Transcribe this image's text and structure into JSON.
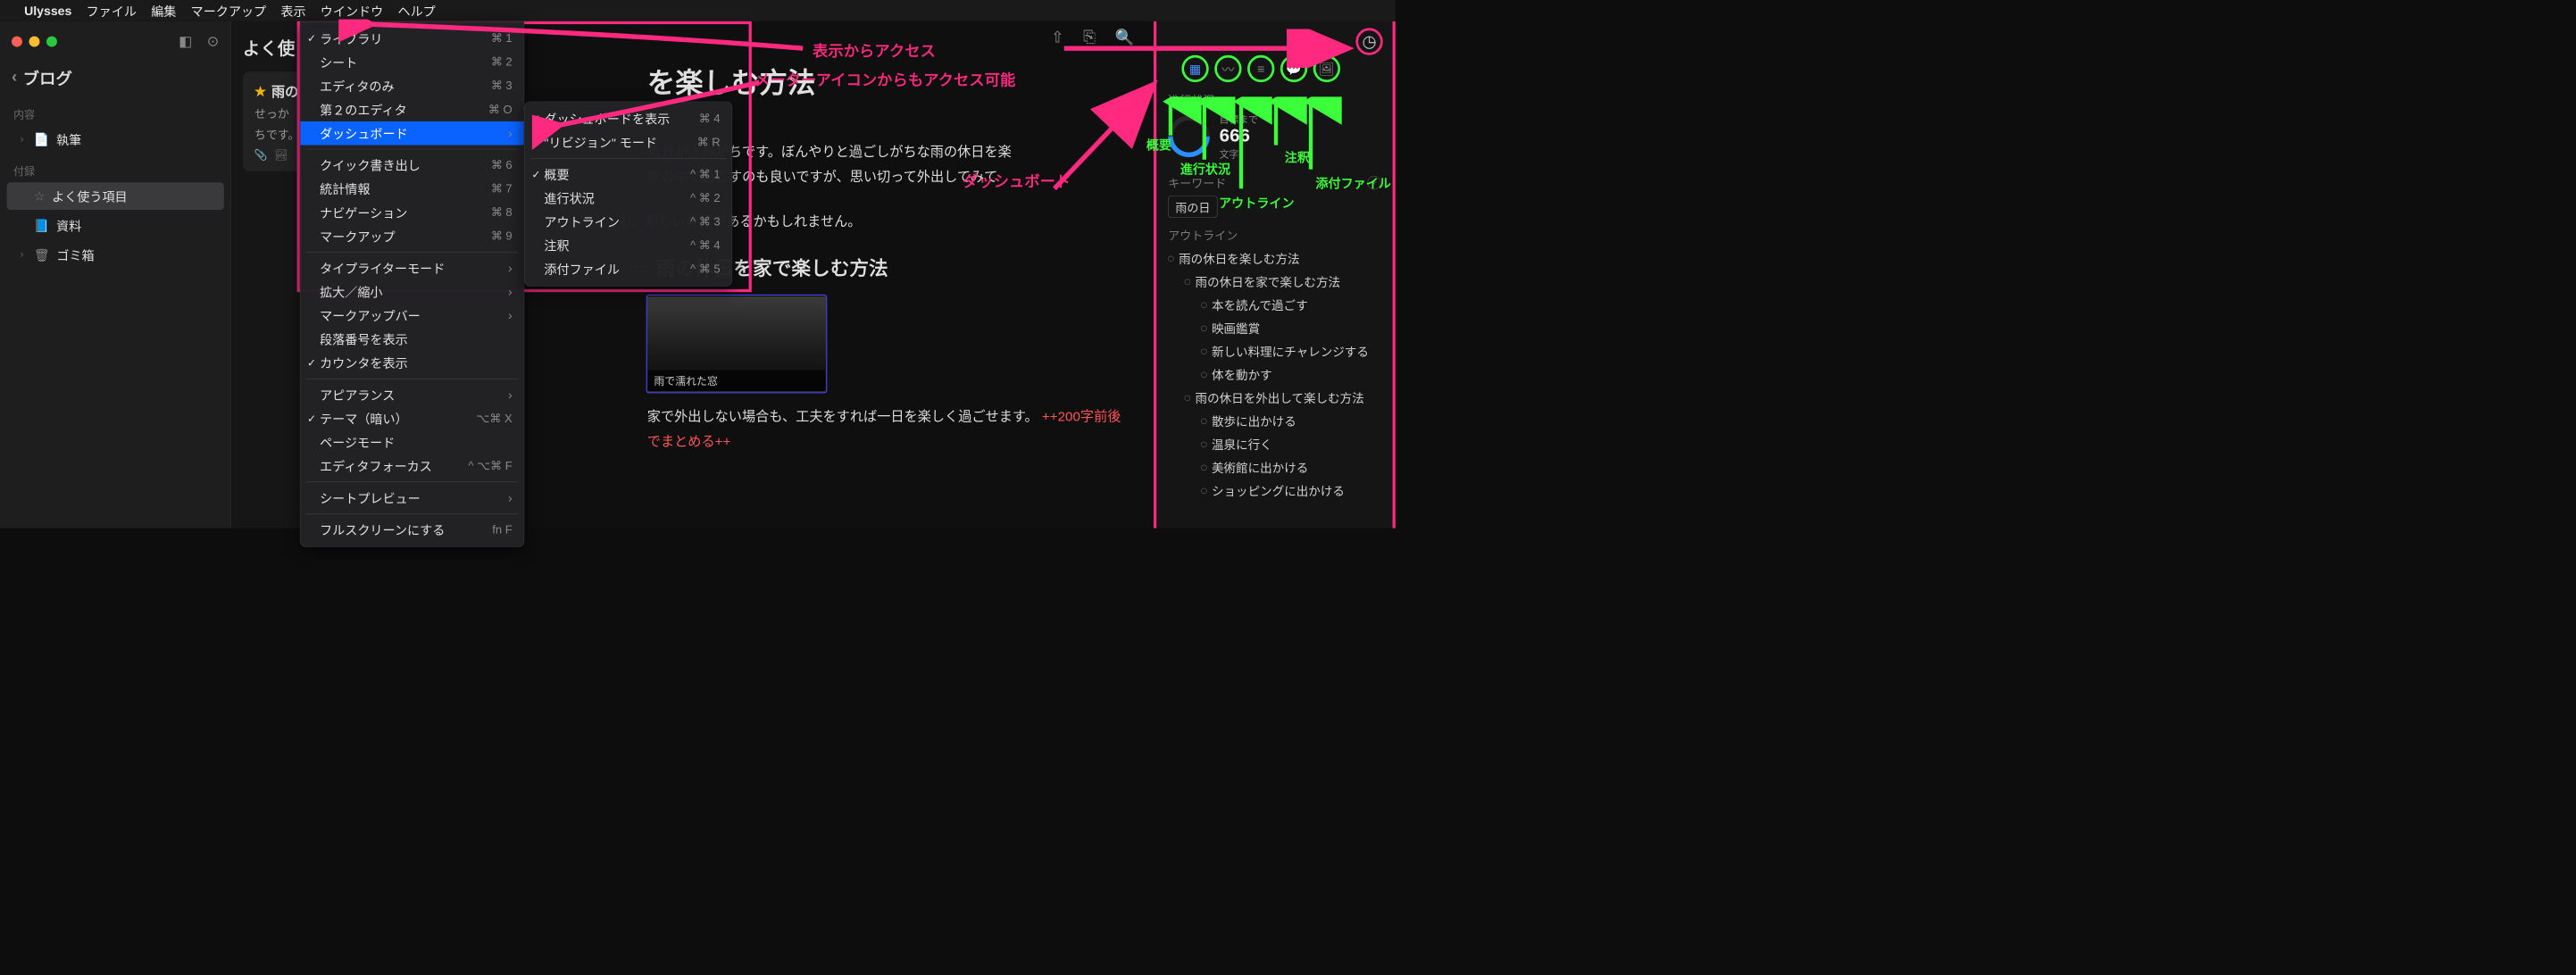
{
  "menubar": {
    "app": "Ulysses",
    "items": [
      "ファイル",
      "編集",
      "マークアップ",
      "表示",
      "ウインドウ",
      "ヘルプ"
    ]
  },
  "view_menu": {
    "items": [
      {
        "label": "ライブラリ",
        "checked": true,
        "shortcut": "⌘ 1"
      },
      {
        "label": "シート",
        "shortcut": "⌘ 2"
      },
      {
        "label": "エディタのみ",
        "shortcut": "⌘ 3"
      },
      {
        "label": "第２のエディタ",
        "shortcut": "⌘ O"
      },
      {
        "label": "ダッシュボード",
        "selected": true,
        "submenu": true
      },
      {
        "sep": true
      },
      {
        "label": "クイック書き出し",
        "shortcut": "⌘ 6"
      },
      {
        "label": "統計情報",
        "shortcut": "⌘ 7"
      },
      {
        "label": "ナビゲーション",
        "shortcut": "⌘ 8"
      },
      {
        "label": "マークアップ",
        "shortcut": "⌘ 9"
      },
      {
        "sep": true
      },
      {
        "label": "タイプライターモード",
        "submenu": true
      },
      {
        "label": "拡大／縮小",
        "submenu": true
      },
      {
        "label": "マークアップバー",
        "submenu": true
      },
      {
        "label": "段落番号を表示"
      },
      {
        "label": "カウンタを表示",
        "checked": true
      },
      {
        "sep": true
      },
      {
        "label": "アピアランス",
        "submenu": true
      },
      {
        "label": "テーマ（暗い）",
        "checked": true,
        "shortcut": "⌥⌘ X"
      },
      {
        "label": "ページモード"
      },
      {
        "label": "エディタフォーカス",
        "shortcut": "^ ⌥⌘ F"
      },
      {
        "sep": true
      },
      {
        "label": "シートプレビュー",
        "submenu": true
      },
      {
        "sep": true
      },
      {
        "label": "フルスクリーンにする",
        "shortcut": "fn F"
      }
    ]
  },
  "dashboard_submenu": {
    "items": [
      {
        "label": "ダッシュボードを表示",
        "checked": true,
        "shortcut": "⌘ 4"
      },
      {
        "label": "\"リビジョン\" モード",
        "shortcut": "⌘ R"
      },
      {
        "sep": true
      },
      {
        "label": "概要",
        "checked": true,
        "shortcut": "^ ⌘ 1"
      },
      {
        "label": "進行状況",
        "shortcut": "^ ⌘ 2"
      },
      {
        "label": "アウトライン",
        "shortcut": "^ ⌘ 3"
      },
      {
        "label": "注釈",
        "shortcut": "^ ⌘ 4"
      },
      {
        "label": "添付ファイル",
        "shortcut": "^ ⌘ 5"
      }
    ]
  },
  "sidebar": {
    "back": "ブログ",
    "section1": "内容",
    "items1": [
      {
        "icon": "doc",
        "label": "執筆"
      }
    ],
    "section2": "付録",
    "items2": [
      {
        "icon": "star",
        "label": "よく使う項目",
        "selected": true
      },
      {
        "icon": "fav",
        "label": "資料"
      },
      {
        "icon": "trash",
        "label": "ゴミ箱"
      }
    ]
  },
  "sheetlist": {
    "title": "よく使",
    "card": {
      "title": "雨の",
      "preview1": "せっか",
      "preview2": "ちです。",
      "attach": "📎",
      "img": "🏞"
    }
  },
  "editor": {
    "h1_suffix": "を楽しむ方法",
    "p1": "気分が沈みがちです。ぼんやりと過ごしがちな雨の休日を楽",
    "p1b": "家の中で過ごすのも良いですが、思い切って外出してみて",
    "p1c": "も、新しい発見があるかもしれません。",
    "h2": "雨の休日を家で楽しむ方法",
    "img_caption": "雨で濡れた窓",
    "p2": "家で外出しない場合も、工夫をすれば一日を楽しく過ごせます。",
    "p2_hl": "++200字前後でまとめる++"
  },
  "dashboard": {
    "tabs": [
      "grid",
      "chart",
      "list",
      "comment",
      "image"
    ],
    "progress_title": "進行状況",
    "progress_label": "目標まで",
    "progress_value": "666",
    "progress_unit": "文字",
    "keyword_title": "キーワード",
    "keyword_tag": "雨の日",
    "outline_title": "アウトライン",
    "outline": [
      {
        "lvl": 1,
        "t": "雨の休日を楽しむ方法"
      },
      {
        "lvl": 2,
        "t": "雨の休日を家で楽しむ方法"
      },
      {
        "lvl": 3,
        "t": "本を読んで過ごす"
      },
      {
        "lvl": 3,
        "t": "映画鑑賞"
      },
      {
        "lvl": 3,
        "t": "新しい料理にチャレンジする"
      },
      {
        "lvl": 3,
        "t": "体を動かす"
      },
      {
        "lvl": 2,
        "t": "雨の休日を外出して楽しむ方法"
      },
      {
        "lvl": 3,
        "t": "散歩に出かける"
      },
      {
        "lvl": 3,
        "t": "温泉に行く"
      },
      {
        "lvl": 3,
        "t": "美術館に出かける"
      },
      {
        "lvl": 3,
        "t": "ショッピングに出かける"
      }
    ]
  },
  "annotations": {
    "a1": "表示からアクセス",
    "a2": "メーターアイコンからもアクセス可能",
    "a3": "ダッシュボード",
    "g1": "概要",
    "g2": "進行状況",
    "g3": "注釈",
    "g4": "アウトライン",
    "g5": "添付ファイル"
  }
}
